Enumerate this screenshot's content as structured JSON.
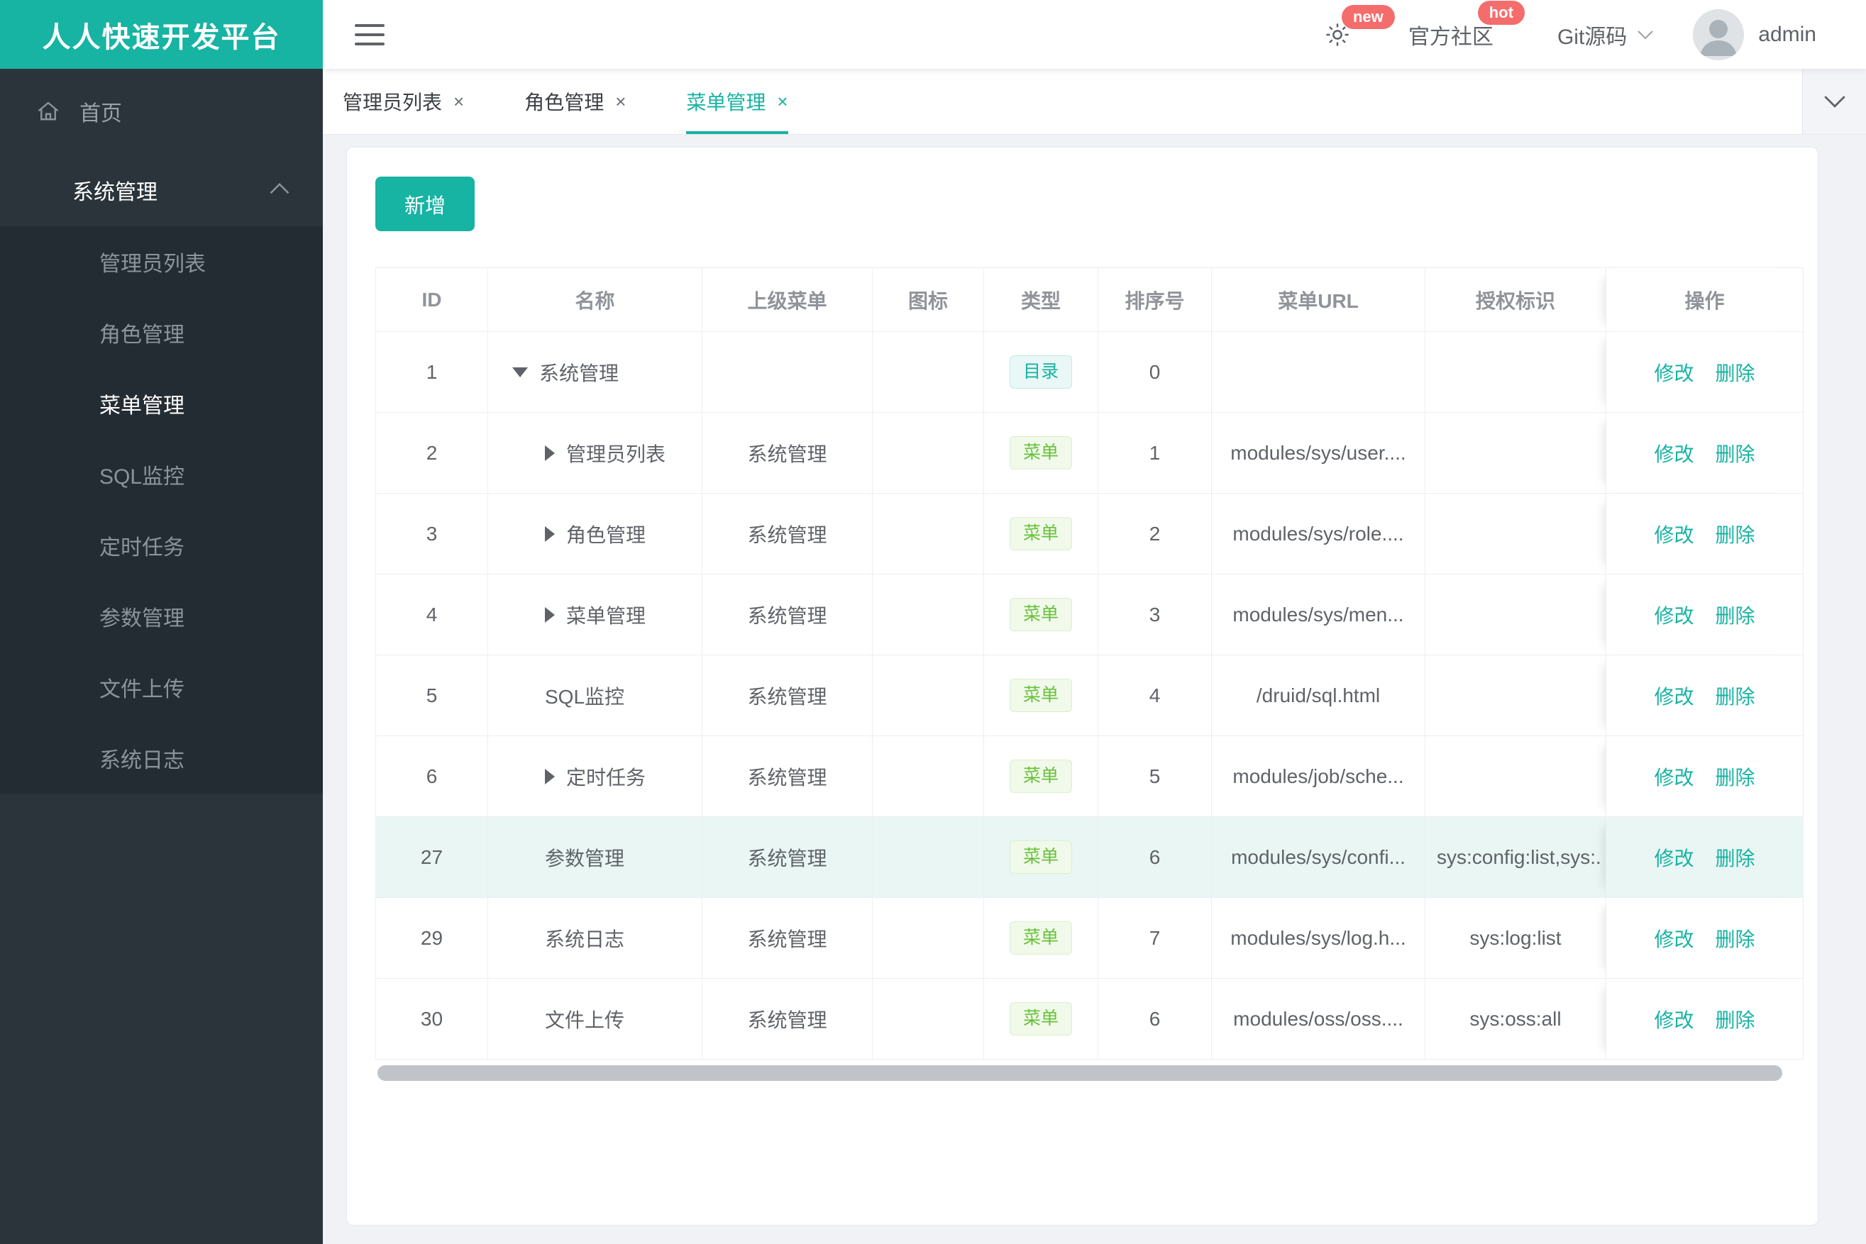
{
  "sidebar": {
    "logo": "人人快速开发平台",
    "home_label": "首页",
    "group_label": "系统管理",
    "items": [
      "管理员列表",
      "角色管理",
      "菜单管理",
      "SQL监控",
      "定时任务",
      "参数管理",
      "文件上传",
      "系统日志"
    ],
    "active_item": "菜单管理"
  },
  "topbar": {
    "badge_new": "new",
    "community_label": "官方社区",
    "badge_hot": "hot",
    "git_label": "Git源码",
    "username": "admin"
  },
  "tabs": [
    {
      "label": "管理员列表",
      "active": false
    },
    {
      "label": "角色管理",
      "active": false
    },
    {
      "label": "菜单管理",
      "active": true
    }
  ],
  "toolbar": {
    "add_label": "新增"
  },
  "table": {
    "columns": [
      "ID",
      "名称",
      "上级菜单",
      "图标",
      "类型",
      "排序号",
      "菜单URL",
      "授权标识",
      "操作"
    ],
    "actions": {
      "edit_label": "修改",
      "delete_label": "删除"
    },
    "rows": [
      {
        "id": "1",
        "arrow": "down",
        "level": 0,
        "name": "系统管理",
        "parent": "",
        "icon": "",
        "type": "目录",
        "type_kind": "dir",
        "order": "0",
        "url": "",
        "perms": "",
        "highlight": false
      },
      {
        "id": "2",
        "arrow": "right",
        "level": 1,
        "name": "管理员列表",
        "parent": "系统管理",
        "icon": "",
        "type": "菜单",
        "type_kind": "menu",
        "order": "1",
        "url": "modules/sys/user....",
        "perms": "",
        "highlight": false
      },
      {
        "id": "3",
        "arrow": "right",
        "level": 1,
        "name": "角色管理",
        "parent": "系统管理",
        "icon": "",
        "type": "菜单",
        "type_kind": "menu",
        "order": "2",
        "url": "modules/sys/role....",
        "perms": "",
        "highlight": false
      },
      {
        "id": "4",
        "arrow": "right",
        "level": 1,
        "name": "菜单管理",
        "parent": "系统管理",
        "icon": "",
        "type": "菜单",
        "type_kind": "menu",
        "order": "3",
        "url": "modules/sys/men...",
        "perms": "",
        "highlight": false
      },
      {
        "id": "5",
        "arrow": null,
        "level": 1,
        "name": "SQL监控",
        "parent": "系统管理",
        "icon": "",
        "type": "菜单",
        "type_kind": "menu",
        "order": "4",
        "url": "/druid/sql.html",
        "perms": "",
        "highlight": false
      },
      {
        "id": "6",
        "arrow": "right",
        "level": 1,
        "name": "定时任务",
        "parent": "系统管理",
        "icon": "",
        "type": "菜单",
        "type_kind": "menu",
        "order": "5",
        "url": "modules/job/sche...",
        "perms": "",
        "highlight": false
      },
      {
        "id": "27",
        "arrow": null,
        "level": 1,
        "name": "参数管理",
        "parent": "系统管理",
        "icon": "",
        "type": "菜单",
        "type_kind": "menu",
        "order": "6",
        "url": "modules/sys/confi...",
        "perms": "sys:config:list,sys:.",
        "highlight": true
      },
      {
        "id": "29",
        "arrow": null,
        "level": 1,
        "name": "系统日志",
        "parent": "系统管理",
        "icon": "",
        "type": "菜单",
        "type_kind": "menu",
        "order": "7",
        "url": "modules/sys/log.h...",
        "perms": "sys:log:list",
        "highlight": false
      },
      {
        "id": "30",
        "arrow": null,
        "level": 1,
        "name": "文件上传",
        "parent": "系统管理",
        "icon": "",
        "type": "菜单",
        "type_kind": "menu",
        "order": "6",
        "url": "modules/oss/oss....",
        "perms": "sys:oss:all",
        "highlight": false
      }
    ]
  },
  "icons": {
    "menu_toggle": "hamburger-icon",
    "settings": "gear-icon",
    "home": "home-icon",
    "group_collapse": "chevron-up-icon",
    "git_dropdown": "chevron-down-icon",
    "tabs_dropdown": "chevron-down-icon",
    "tab_close_glyph": "×",
    "tree_expanded": "triangle-down-icon",
    "tree_collapsed": "triangle-right-icon",
    "avatar": "user-avatar"
  },
  "colors": {
    "accent": "#17b3a3",
    "danger_badge": "#f56c6c",
    "tag_dir": "#14b2a4",
    "tag_menu": "#67c23a",
    "row_highlight": "#e9f6f3",
    "sidebar_bg": "#2b343b",
    "submenu_bg": "#242c33"
  }
}
